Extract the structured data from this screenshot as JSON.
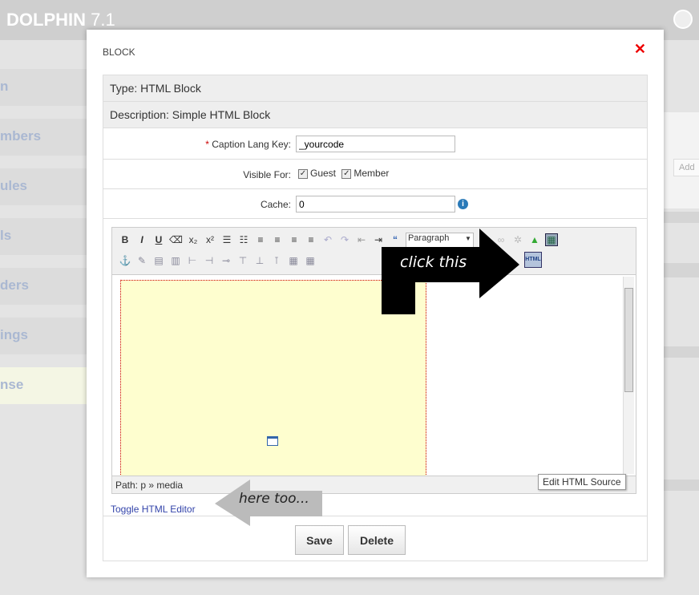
{
  "app": {
    "title_bold": "DOLPHIN",
    "title_version": " 7.1"
  },
  "sidebar": {
    "items": [
      "n",
      "mbers",
      "ules",
      "ls",
      "ders",
      "ings",
      "nse"
    ]
  },
  "right": {
    "add_label": "Add"
  },
  "dialog": {
    "title": "BLOCK",
    "type": "Type: HTML Block",
    "description": "Description: Simple HTML Block",
    "caption_label": "Caption Lang Key:",
    "caption_value": "_yourcode",
    "required_mark": "*",
    "visible_label": "Visible For:",
    "guest": "Guest",
    "member": "Member",
    "guest_checked": true,
    "member_checked": true,
    "cache_label": "Cache:",
    "cache_value": "0",
    "editor": {
      "format_value": "Paragraph",
      "path": "Path: p » media",
      "tooltip": "Edit HTML Source",
      "html_btn": "HTML",
      "row1": [
        "B",
        "I",
        "U",
        "⌫",
        "x₂",
        "x²",
        "☰",
        "☷",
        "≡",
        "≡",
        "≡",
        "≡",
        "↶",
        "↷",
        "⇤",
        "⇥",
        "“"
      ],
      "row2": [
        "⚓",
        "✎",
        "▤",
        "▥",
        "⊢",
        "⊣",
        "⊸",
        "⊤",
        "⊥",
        "⊺",
        "▦",
        "▦"
      ]
    },
    "toggle_link": "Toggle HTML Editor",
    "save": "Save",
    "delete": "Delete"
  },
  "annotations": {
    "click": "click this",
    "here": "here too..."
  }
}
